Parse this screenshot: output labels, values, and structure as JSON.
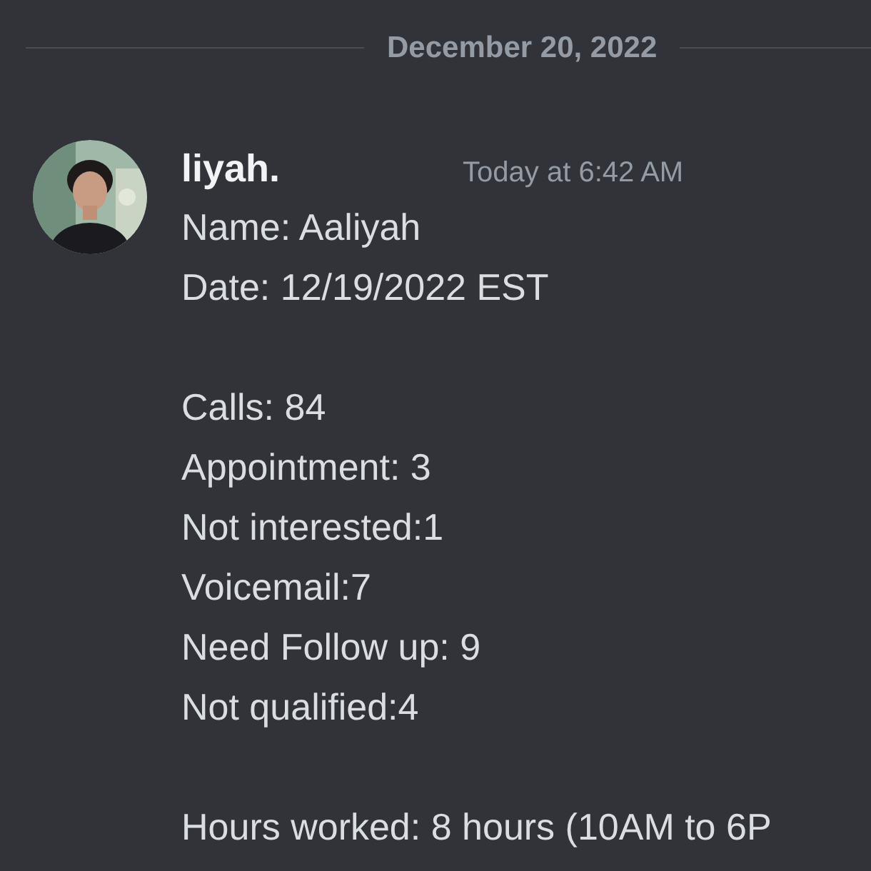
{
  "divider": {
    "date": "December 20, 2022"
  },
  "message": {
    "author": "liyah.",
    "timestamp": "Today at 6:42 AM",
    "avatar": {
      "kind": "picture"
    },
    "paragraphs": [
      [
        "Name: Aaliyah",
        "Date: 12/19/2022 EST"
      ],
      [
        "Calls: 84",
        "Appointment: 3",
        "Not interested:1",
        "Voicemail:7",
        "Need Follow up: 9",
        "Not qualified:4"
      ],
      [
        "Hours worked: 8 hours (10AM to 6P"
      ]
    ]
  }
}
